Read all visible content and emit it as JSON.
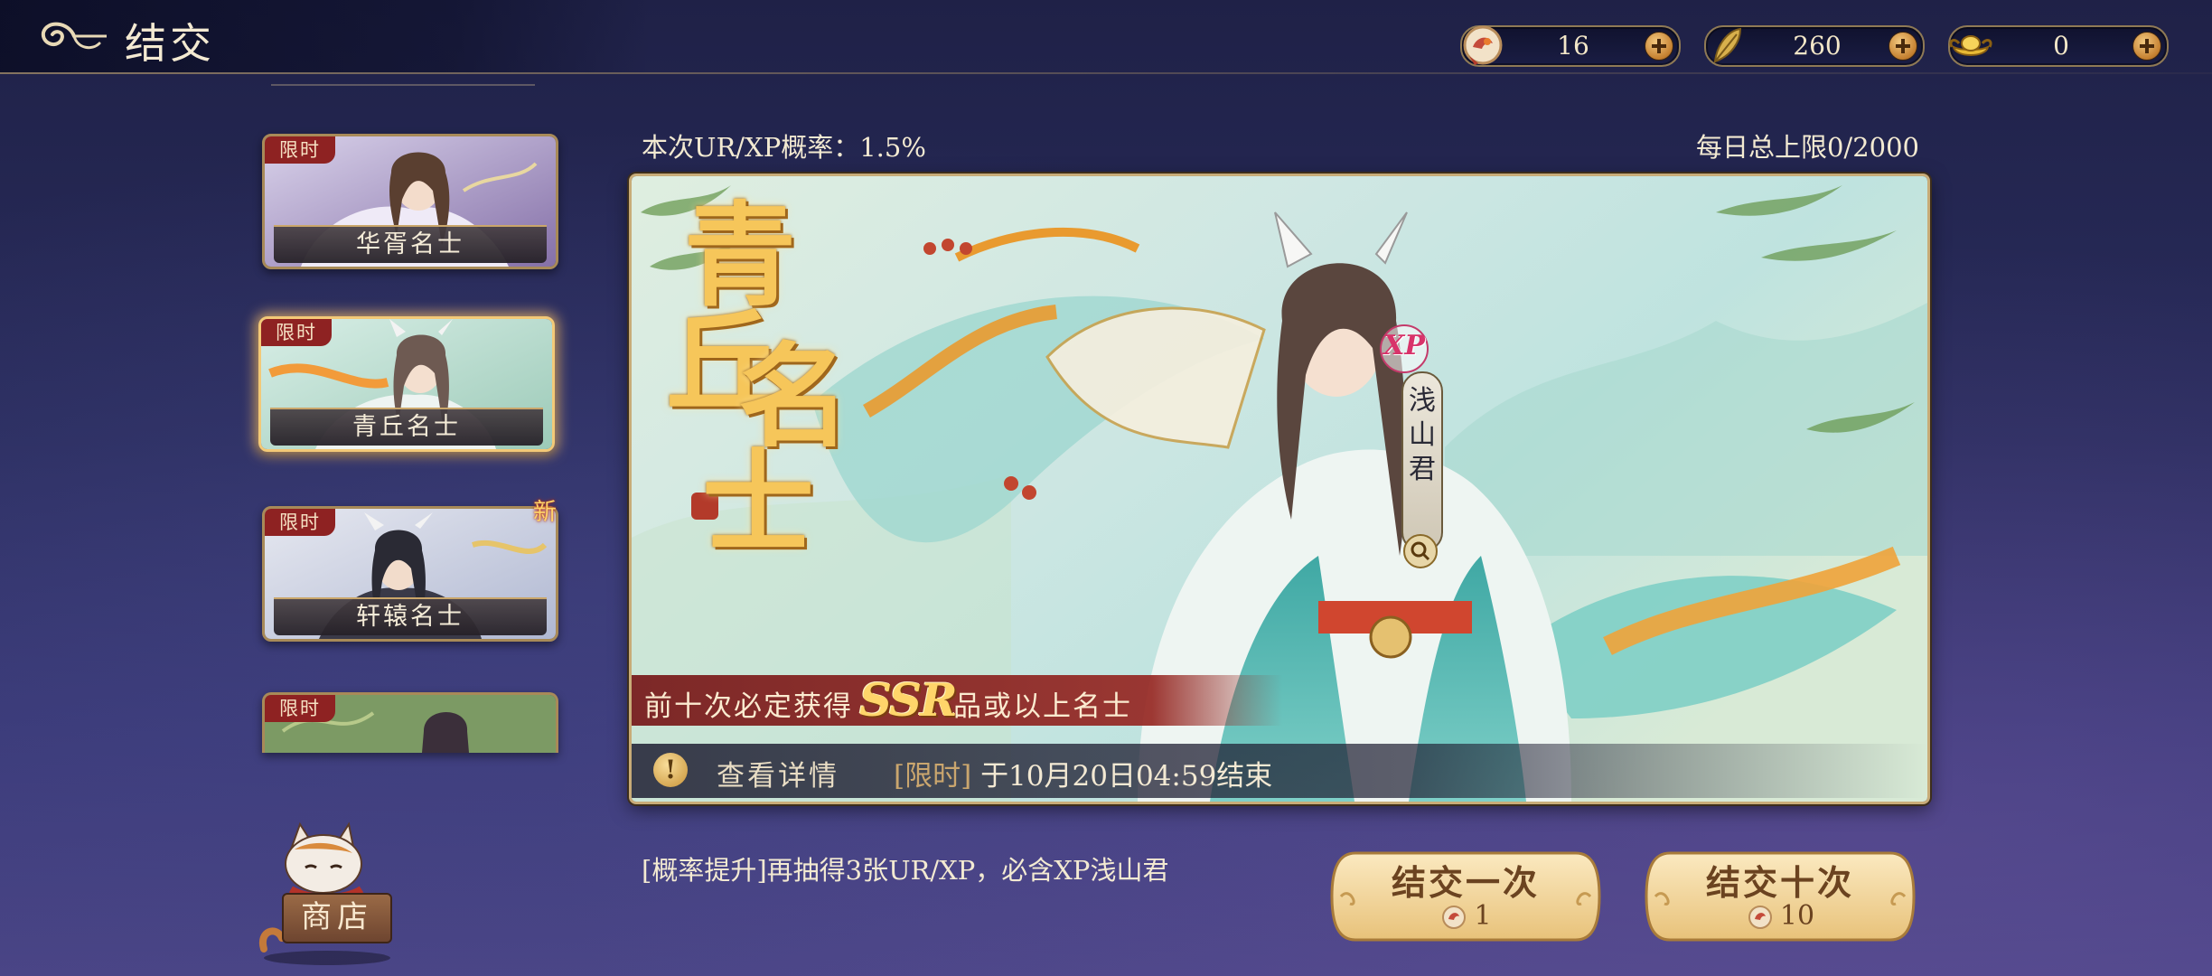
{
  "header": {
    "title": "结交",
    "back_icon": "back-cloud-icon"
  },
  "resources": [
    {
      "name": "token-icon",
      "value": "16"
    },
    {
      "name": "feather-icon",
      "value": "260"
    },
    {
      "name": "ingot-icon",
      "value": "0"
    }
  ],
  "banner_list": [
    {
      "tag": "限时",
      "name": "华胥名士",
      "selected": false
    },
    {
      "tag": "限时",
      "name": "青丘名士",
      "selected": true
    },
    {
      "tag": "限时",
      "name": "轩辕名士",
      "selected": false,
      "badge": "新"
    },
    {
      "tag": "限时",
      "name": "",
      "selected": false
    }
  ],
  "shop": {
    "label": "商店"
  },
  "banner": {
    "rate_text": "本次UR/XP概率：1.5%",
    "limit_text": "每日总上限0/2000",
    "title_chars": [
      "青",
      "丘",
      "名",
      "士"
    ],
    "featured_rarity": "XP",
    "featured_name": [
      "浅",
      "山",
      "君"
    ],
    "guarantee_pre": "前十次必定获得",
    "guarantee_rarity": "SSR",
    "guarantee_post": "品或以上名士",
    "details_label": "查看详情",
    "end_limit": "[限时]",
    "end_time": "于10月20日04:59结束"
  },
  "pity_text": "[概率提升]再抽得3张UR/XP，必含XP浅山君",
  "pull_buttons": [
    {
      "label": "结交一次",
      "cost": "1",
      "cost_icon": "token-icon"
    },
    {
      "label": "结交十次",
      "cost": "10",
      "cost_icon": "token-icon"
    }
  ],
  "colors": {
    "accent_gold": "#f6c65a",
    "tag_red": "#8e2222",
    "frame_gold": "#c8ac78"
  }
}
